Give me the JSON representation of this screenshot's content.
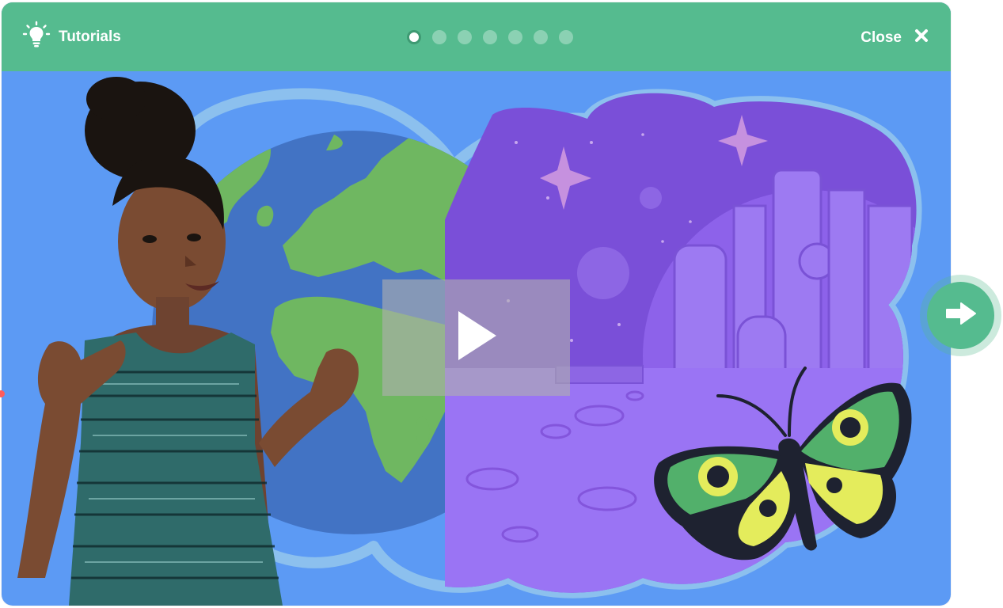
{
  "header": {
    "title": "Tutorials",
    "title_icon": "lightbulb-icon",
    "close_label": "Close",
    "close_icon": "close-icon",
    "progress": {
      "total_steps": 7,
      "current_step": 1
    }
  },
  "video": {
    "play_icon": "play-icon"
  },
  "navigation": {
    "next_icon": "arrow-right-icon"
  },
  "colors": {
    "header": "#55bb8f",
    "background": "#5c9af4",
    "earth_ocean": "#4273c4",
    "land": "#6fb761",
    "space": "#7a4fd8",
    "moon": "#9a74f4",
    "butterfly_green": "#52b06b",
    "butterfly_yellow": "#e4ec5c"
  }
}
